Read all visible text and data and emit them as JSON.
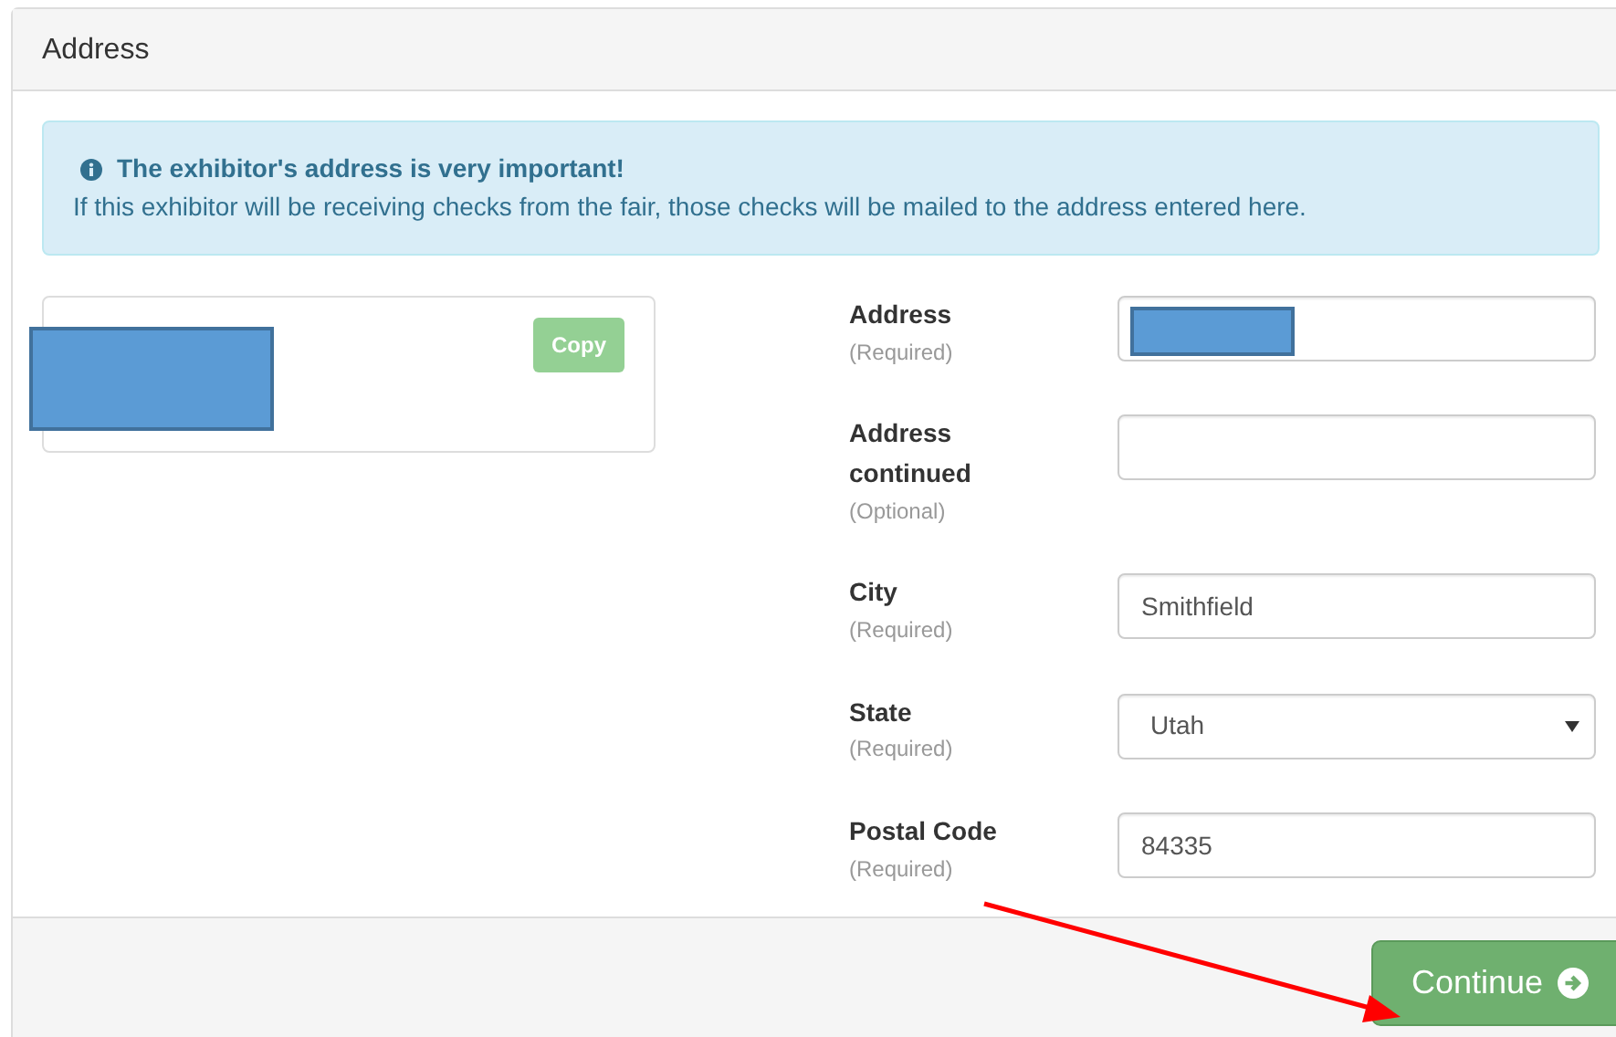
{
  "panel": {
    "title": "Address"
  },
  "alert": {
    "heading": "The exhibitor's address is very important!",
    "text": "If this exhibitor will be receiving checks from the fair, those checks will be mailed to the address entered here."
  },
  "address_card": {
    "redacted": true,
    "copy_button": {
      "label": "Copy",
      "disabled": true
    }
  },
  "fields": [
    {
      "kind": "text",
      "label": "Address",
      "note": "(Required)",
      "redacted": true
    },
    {
      "kind": "text",
      "label": "Address continued",
      "note": "(Optional)",
      "redacted": false
    },
    {
      "kind": "text",
      "label": "City",
      "note": "(Required)",
      "value": "Smithfield",
      "redacted": false
    },
    {
      "kind": "select",
      "label": "State",
      "note": "(Required)",
      "value": "Utah",
      "redacted": false
    },
    {
      "kind": "text",
      "label": "Postal Code",
      "note": "(Required)",
      "value": "84335",
      "redacted": false
    }
  ],
  "footer": {
    "continue_button": {
      "label": "Continue"
    }
  }
}
